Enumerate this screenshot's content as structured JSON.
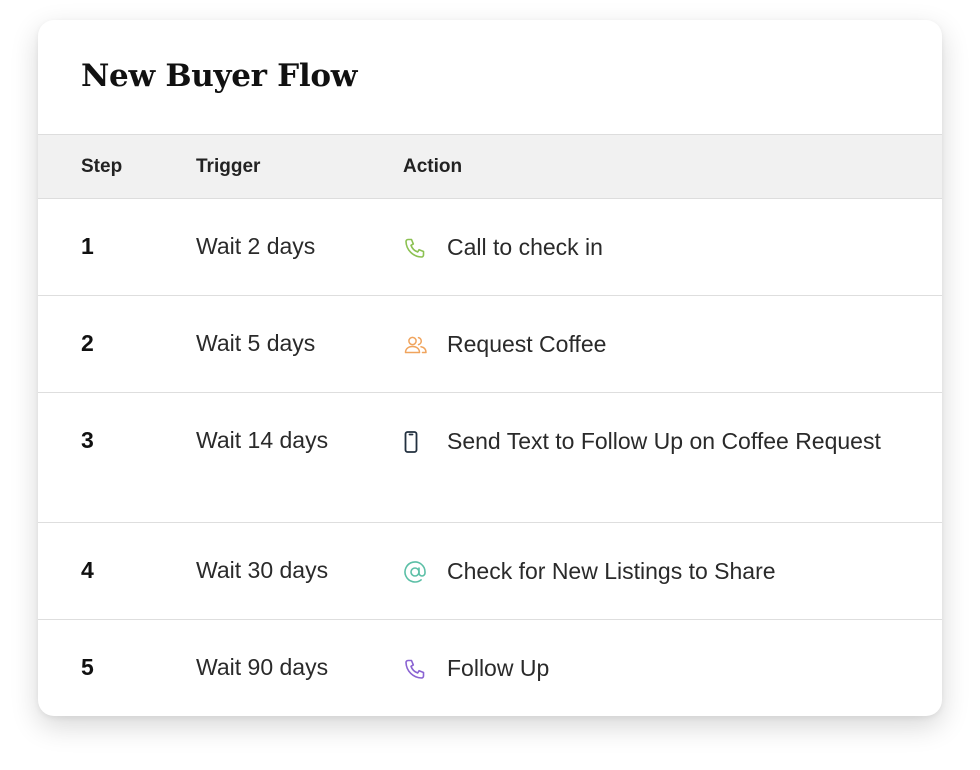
{
  "flow": {
    "title": "New Buyer Flow",
    "columns": {
      "step": "Step",
      "trigger": "Trigger",
      "action": "Action"
    },
    "rows": [
      {
        "step": "1",
        "trigger": "Wait 2 days",
        "action": "Call to check in",
        "icon": "phone-icon",
        "icon_color": "#8cc152"
      },
      {
        "step": "2",
        "trigger": "Wait 5 days",
        "action": "Request Coffee",
        "icon": "people-icon",
        "icon_color": "#f0a45d"
      },
      {
        "step": "3",
        "trigger": "Wait 14 days",
        "action": "Send Text to Follow Up on Coffee Request",
        "icon": "mobile-icon",
        "icon_color": "#22303f"
      },
      {
        "step": "4",
        "trigger": "Wait 30 days",
        "action": "Check for New Listings to Share",
        "icon": "at-sign-icon",
        "icon_color": "#5bbfa6"
      },
      {
        "step": "5",
        "trigger": "Wait 90 days",
        "action": "Follow Up",
        "icon": "phone-icon",
        "icon_color": "#8a63d2"
      }
    ]
  }
}
